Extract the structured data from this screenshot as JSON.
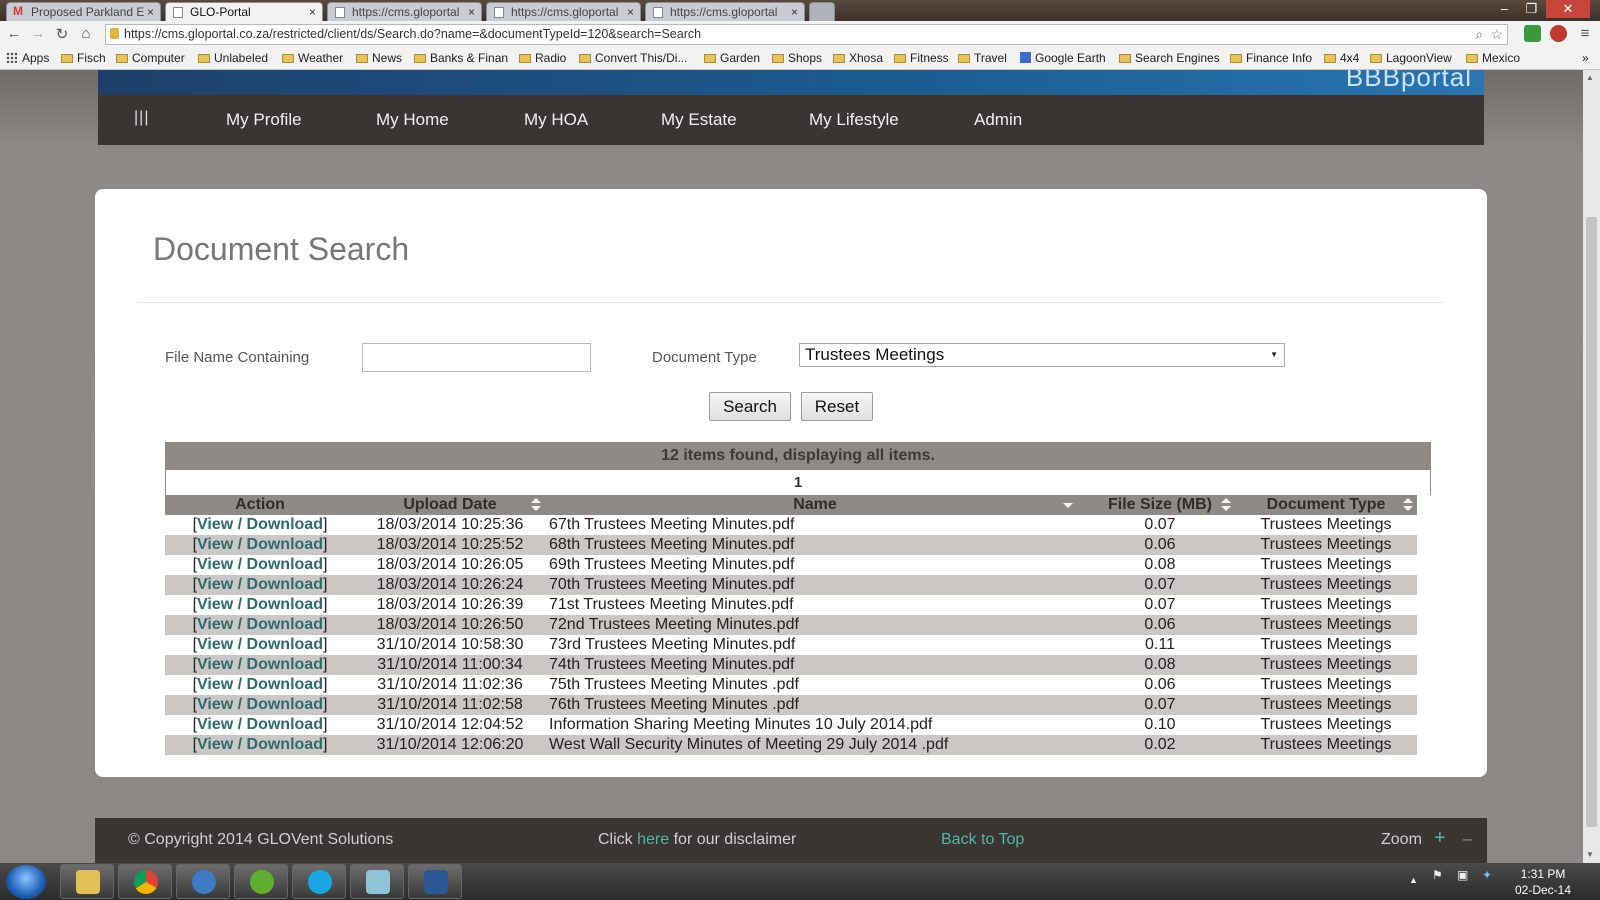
{
  "browser": {
    "tabs": [
      {
        "label": "Proposed Parkland E",
        "icon": "gmail-icon",
        "active": false
      },
      {
        "label": "GLO-Portal",
        "icon": "page-icon",
        "active": true
      },
      {
        "label": "https://cms.gloportal",
        "icon": "page-icon",
        "active": false
      },
      {
        "label": "https://cms.gloportal",
        "icon": "page-icon",
        "active": false
      },
      {
        "label": "https://cms.gloportal",
        "icon": "page-icon",
        "active": false
      }
    ],
    "tab_close": "×",
    "url": "https://cms.gloportal.co.za/restricted/client/ds/Search.do?name=&documentTypeId=120&search=Search",
    "bookmarks": [
      "Apps",
      "Fisch",
      "Computer",
      "Unlabeled",
      "Weather",
      "News",
      "Banks & Finan",
      "Radio",
      "Convert This/Di...",
      "Garden",
      "Shops",
      "Xhosa",
      "Fitness",
      "Travel",
      "Google Earth",
      "Search Engines",
      "Finance Info",
      "4x4",
      "LagoonView",
      "Mexico"
    ],
    "bookmarks_more": "»"
  },
  "site": {
    "brand": "BBBportal",
    "menu_icon": "|||",
    "nav": [
      "My Profile",
      "My Home",
      "My HOA",
      "My Estate",
      "My Lifestyle",
      "Admin"
    ]
  },
  "search": {
    "title": "Document Search",
    "file_name_label": "File Name Containing",
    "file_name_value": "",
    "doc_type_label": "Document Type",
    "doc_type_value": "Trustees Meetings",
    "search_button": "Search",
    "reset_button": "Reset"
  },
  "results": {
    "summary": "12 items found, displaying all items.",
    "page": "1",
    "columns": [
      "Action",
      "Upload Date",
      "Name",
      "File Size (MB)",
      "Document Type"
    ],
    "action_label": "View / Download",
    "rows": [
      {
        "date": "18/03/2014 10:25:36",
        "name": "67th Trustees Meeting Minutes.pdf",
        "size": "0.07",
        "type": "Trustees Meetings"
      },
      {
        "date": "18/03/2014 10:25:52",
        "name": "68th Trustees Meeting Minutes.pdf",
        "size": "0.06",
        "type": "Trustees Meetings"
      },
      {
        "date": "18/03/2014 10:26:05",
        "name": "69th Trustees Meeting Minutes.pdf",
        "size": "0.08",
        "type": "Trustees Meetings"
      },
      {
        "date": "18/03/2014 10:26:24",
        "name": "70th Trustees Meeting Minutes.pdf",
        "size": "0.07",
        "type": "Trustees Meetings"
      },
      {
        "date": "18/03/2014 10:26:39",
        "name": "71st Trustees Meeting Minutes.pdf",
        "size": "0.07",
        "type": "Trustees Meetings"
      },
      {
        "date": "18/03/2014 10:26:50",
        "name": "72nd Trustees Meeting Minutes.pdf",
        "size": "0.06",
        "type": "Trustees Meetings"
      },
      {
        "date": "31/10/2014 10:58:30",
        "name": "73rd Trustees Meeting Minutes.pdf",
        "size": "0.11",
        "type": "Trustees Meetings"
      },
      {
        "date": "31/10/2014 11:00:34",
        "name": "74th Trustees Meeting Minutes.pdf",
        "size": "0.08",
        "type": "Trustees Meetings"
      },
      {
        "date": "31/10/2014 11:02:36",
        "name": "75th Trustees Meeting Minutes .pdf",
        "size": "0.06",
        "type": "Trustees Meetings"
      },
      {
        "date": "31/10/2014 11:02:58",
        "name": "76th Trustees Meeting Minutes .pdf",
        "size": "0.07",
        "type": "Trustees Meetings"
      },
      {
        "date": "31/10/2014 12:04:52",
        "name": "Information Sharing Meeting Minutes 10 July 2014.pdf",
        "size": "0.10",
        "type": "Trustees Meetings"
      },
      {
        "date": "31/10/2014 12:06:20",
        "name": "West Wall Security Minutes of Meeting 29 July 2014 .pdf",
        "size": "0.02",
        "type": "Trustees Meetings"
      }
    ]
  },
  "footer": {
    "copyright": "© Copyright 2014 GLOVent Solutions",
    "disclaimer_prefix": "Click",
    "disclaimer_link": "here",
    "disclaimer_suffix": "for our disclaimer",
    "back_to_top": "Back to Top",
    "zoom_label": "Zoom",
    "zoom_in": "+",
    "zoom_out": "–"
  },
  "taskbar": {
    "time": "1:31 PM",
    "date": "02-Dec-14"
  },
  "colors": {
    "link": "#2e6b6b",
    "header_bar": "#8f8a86",
    "nav_bg": "#3a3532",
    "footer_link": "#4fb6a9"
  }
}
